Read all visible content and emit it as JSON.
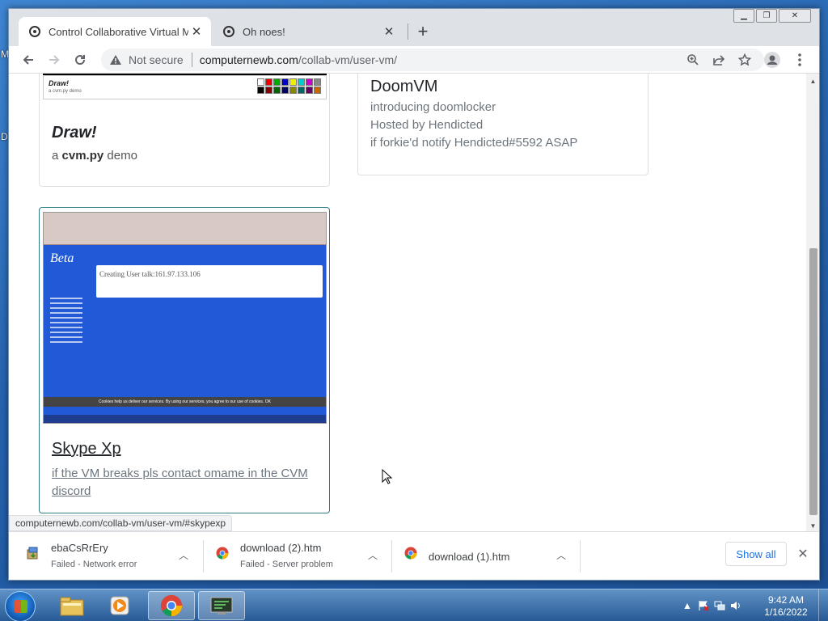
{
  "desktop": {
    "left_letters": [
      "M",
      "D"
    ]
  },
  "tabs": [
    {
      "title": "Control Collaborative Virtual Ma"
    },
    {
      "title": "Oh noes!"
    }
  ],
  "toolbar": {
    "security_label": "Not secure",
    "url_host": "computernewb.com",
    "url_path": "/collab-vm/user-vm/"
  },
  "cards": {
    "draw": {
      "thumb_title": "Draw!",
      "thumb_sub": "a cvm.py demo",
      "title": "Draw!",
      "sub_prefix": "a ",
      "sub_bold": "cvm.py",
      "sub_suffix": " demo"
    },
    "doom": {
      "title": "DoomVM",
      "lines": [
        "introducing doomlocker",
        "Hosted by Hendicted",
        "if forkie'd notify Hendicted#5592 ASAP"
      ]
    },
    "skype": {
      "title": "Skype Xp",
      "subtitle": "if the VM breaks pls contact omame in the CVM discord",
      "thumb_heading": "Creating User talk:161.97.133.106",
      "thumb_logo": "Beta",
      "thumb_cookie": "Cookies help us deliver our services. By using our services, you agree to our use of cookies.  OK"
    }
  },
  "status_url": "computernewb.com/collab-vm/user-vm/#skypexp",
  "downloads": [
    {
      "name": "ebaCsRrEry",
      "status": "Failed - Network error"
    },
    {
      "name": "download (2).htm",
      "status": "Failed - Server problem"
    },
    {
      "name": "download (1).htm",
      "status": ""
    }
  ],
  "show_all_label": "Show all",
  "taskbar": {
    "time": "9:42 AM",
    "date": "1/16/2022"
  },
  "colors": {
    "accent": "#1a73e8",
    "card_hover_border": "#2e7d86",
    "wiki_blue": "#2159d6"
  }
}
